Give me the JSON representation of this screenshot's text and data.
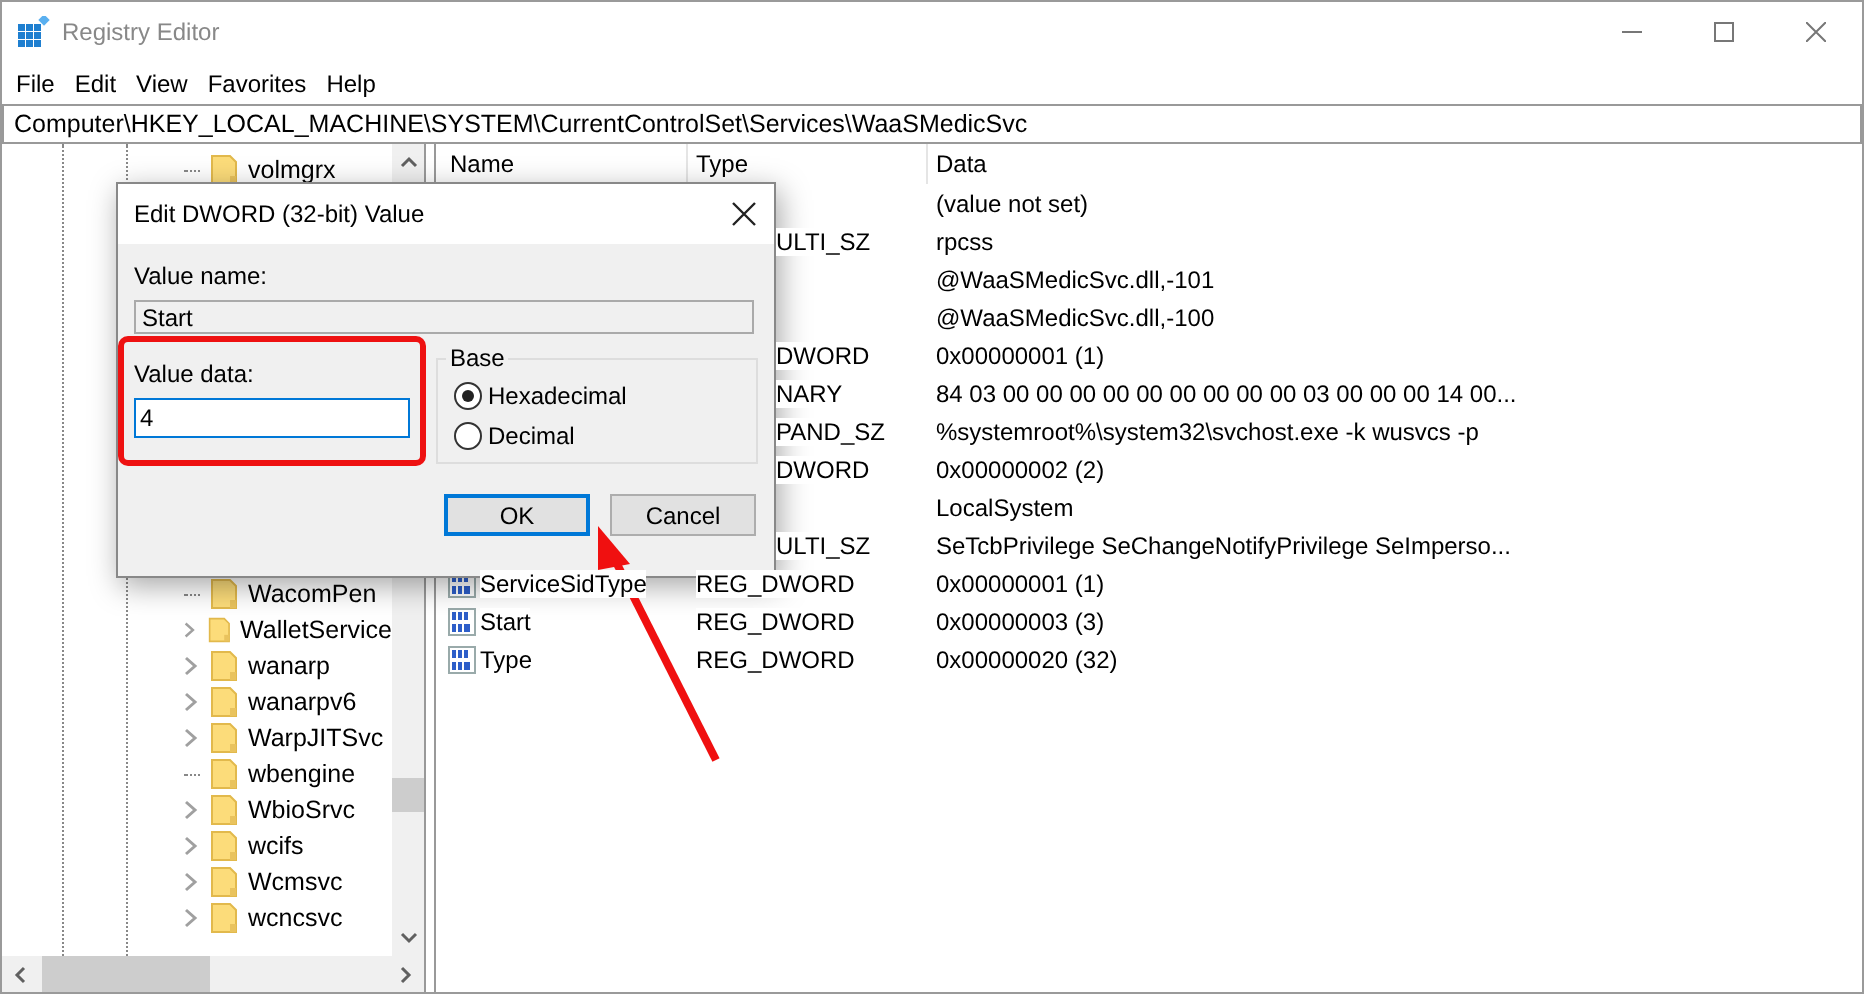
{
  "window": {
    "title": "Registry Editor"
  },
  "menu": [
    "File",
    "Edit",
    "View",
    "Favorites",
    "Help"
  ],
  "address": "Computer\\HKEY_LOCAL_MACHINE\\SYSTEM\\CurrentControlSet\\Services\\WaaSMedicSvc",
  "tree": {
    "items": [
      {
        "label": "volmgrx",
        "expandable": false
      },
      {
        "label": "WacomPen",
        "expandable": false
      },
      {
        "label": "WalletService",
        "expandable": true
      },
      {
        "label": "wanarp",
        "expandable": true
      },
      {
        "label": "wanarpv6",
        "expandable": true
      },
      {
        "label": "WarpJITSvc",
        "expandable": true
      },
      {
        "label": "wbengine",
        "expandable": false
      },
      {
        "label": "WbioSrvc",
        "expandable": true
      },
      {
        "label": "wcifs",
        "expandable": true
      },
      {
        "label": "Wcmsvc",
        "expandable": true
      },
      {
        "label": "wcncsvc",
        "expandable": true
      }
    ]
  },
  "values": {
    "columns": [
      "Name",
      "Type",
      "Data"
    ],
    "rows": [
      {
        "data": "(value not set)"
      },
      {
        "type": "ULTI_SZ",
        "data": "rpcss"
      },
      {
        "data": "@WaaSMedicSvc.dll,-101"
      },
      {
        "data": "@WaaSMedicSvc.dll,-100"
      },
      {
        "type": "DWORD",
        "data": "0x00000001 (1)"
      },
      {
        "type": "NARY",
        "data": "84 03 00 00 00 00 00 00 00 00 00 03 00 00 00 14 00..."
      },
      {
        "type": "PAND_SZ",
        "data": "%systemroot%\\system32\\svchost.exe -k wusvcs -p"
      },
      {
        "type": "DWORD",
        "data": "0x00000002 (2)"
      },
      {
        "data": "LocalSystem"
      },
      {
        "type": "ULTI_SZ",
        "data": "SeTcbPrivilege SeChangeNotifyPrivilege SeImperso..."
      },
      {
        "name": "ServiceSidType",
        "type": "REG_DWORD",
        "data": "0x00000001 (1)"
      },
      {
        "name": "Start",
        "type": "REG_DWORD",
        "data": "0x00000003 (3)"
      },
      {
        "name": "Type",
        "type": "REG_DWORD",
        "data": "0x00000020 (32)"
      }
    ]
  },
  "dialog": {
    "title": "Edit DWORD (32-bit) Value",
    "value_name_label": "Value name:",
    "value_name": "Start",
    "value_data_label": "Value data:",
    "value_data": "4",
    "base": {
      "label": "Base",
      "options": [
        {
          "label": "Hexadecimal",
          "selected": true
        },
        {
          "label": "Decimal",
          "selected": false
        }
      ]
    },
    "buttons": [
      {
        "label": "OK",
        "focused": true
      },
      {
        "label": "Cancel",
        "focused": false
      }
    ]
  }
}
